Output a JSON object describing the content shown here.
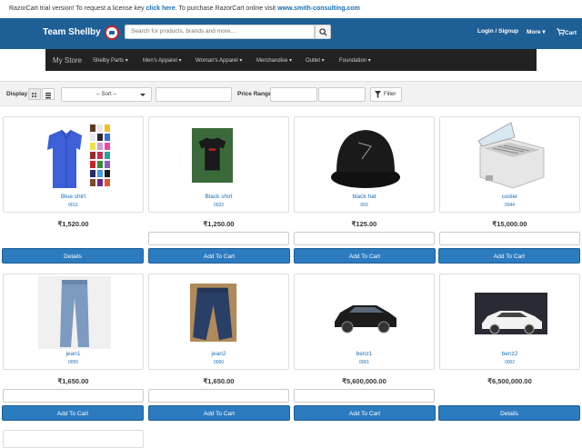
{
  "trial_banner": {
    "prefix": "RazorCart trial version! To request a license key ",
    "link1": "click here",
    "middle": ". To purchase RazorCart online visit ",
    "link2": "www.smith-consulting.com"
  },
  "header": {
    "brand": "Team Shellby",
    "search_placeholder": "Search for products, brands and more...",
    "login": "Login / Signup",
    "more": "More",
    "cart": "Cart"
  },
  "category_nav": {
    "store": "My Store",
    "items": [
      "Shelby Parts",
      "Men's Apparel",
      "Woman's Apparel",
      "Merchandise",
      "Outlet",
      "Foundation"
    ]
  },
  "filter_bar": {
    "display_label": "Display",
    "sort_value": "-- Sort --",
    "price_label": "Price Range",
    "filter_button": "Filter"
  },
  "products": [
    {
      "name": "Blue shirt",
      "code": "0011",
      "price": "₹1,520.00",
      "action": "Details",
      "has_qty": false
    },
    {
      "name": "Black shirt",
      "code": "0022",
      "price": "₹1,250.00",
      "action": "Add To Cart",
      "has_qty": true
    },
    {
      "name": "black hat",
      "code": "003",
      "price": "₹125.00",
      "action": "Add To Cart",
      "has_qty": true
    },
    {
      "name": "cooler",
      "code": "0044",
      "price": "₹15,000.00",
      "action": "Add To Cart",
      "has_qty": true
    },
    {
      "name": "jean1",
      "code": "0055",
      "price": "₹1,650.00",
      "action": "Add To Cart",
      "has_qty": true
    },
    {
      "name": "jean2",
      "code": "0066",
      "price": "₹1,650.00",
      "action": "Add To Cart",
      "has_qty": true
    },
    {
      "name": "benz1",
      "code": "0001",
      "price": "₹5,600,000.00",
      "action": "Add To Cart",
      "has_qty": true
    },
    {
      "name": "benz2",
      "code": "0002",
      "price": "₹6,500,000.00",
      "action": "Details",
      "has_qty": false
    }
  ],
  "colors": {
    "header_bg": "#1e5f96",
    "category_nav_bg": "#222222",
    "button_bg": "#2c7bbf",
    "link": "#1a6fb5"
  }
}
